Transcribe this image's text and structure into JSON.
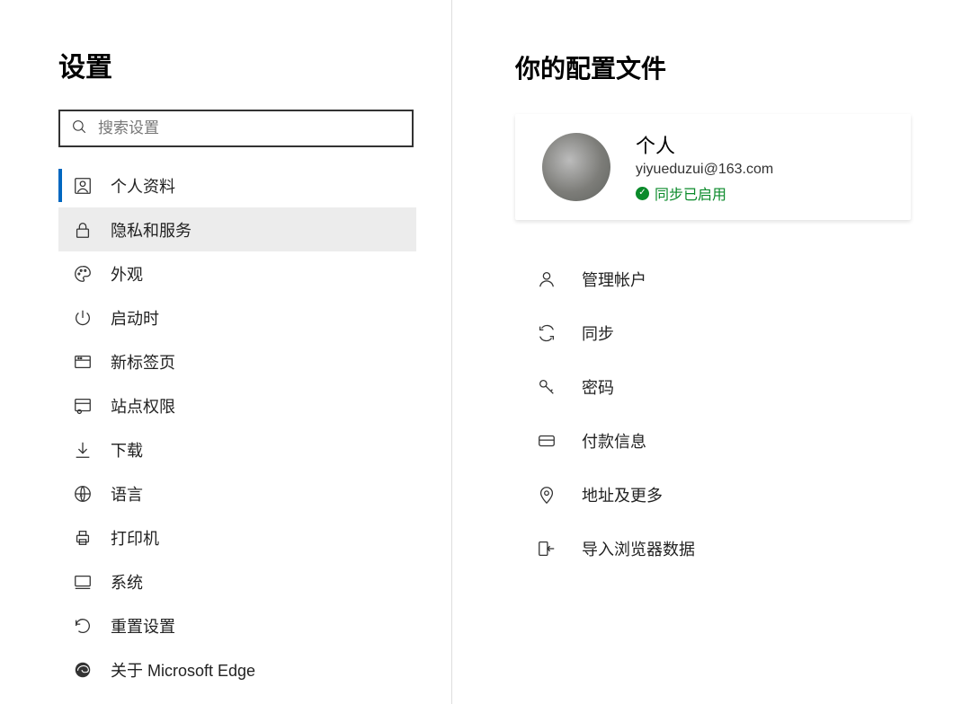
{
  "sidebar": {
    "title": "设置",
    "search_placeholder": "搜索设置",
    "items": [
      {
        "label": "个人资料"
      },
      {
        "label": "隐私和服务"
      },
      {
        "label": "外观"
      },
      {
        "label": "启动时"
      },
      {
        "label": "新标签页"
      },
      {
        "label": "站点权限"
      },
      {
        "label": "下载"
      },
      {
        "label": "语言"
      },
      {
        "label": "打印机"
      },
      {
        "label": "系统"
      },
      {
        "label": "重置设置"
      },
      {
        "label": "关于 Microsoft Edge"
      }
    ]
  },
  "main": {
    "title": "你的配置文件",
    "profile": {
      "name": "个人",
      "email": "yiyueduzui@163.com",
      "sync_status": "同步已启用"
    },
    "options": [
      {
        "label": "管理帐户"
      },
      {
        "label": "同步"
      },
      {
        "label": "密码"
      },
      {
        "label": "付款信息"
      },
      {
        "label": "地址及更多"
      },
      {
        "label": "导入浏览器数据"
      }
    ]
  },
  "colors": {
    "accent": "#0067c0",
    "success": "#0a8a2a"
  }
}
